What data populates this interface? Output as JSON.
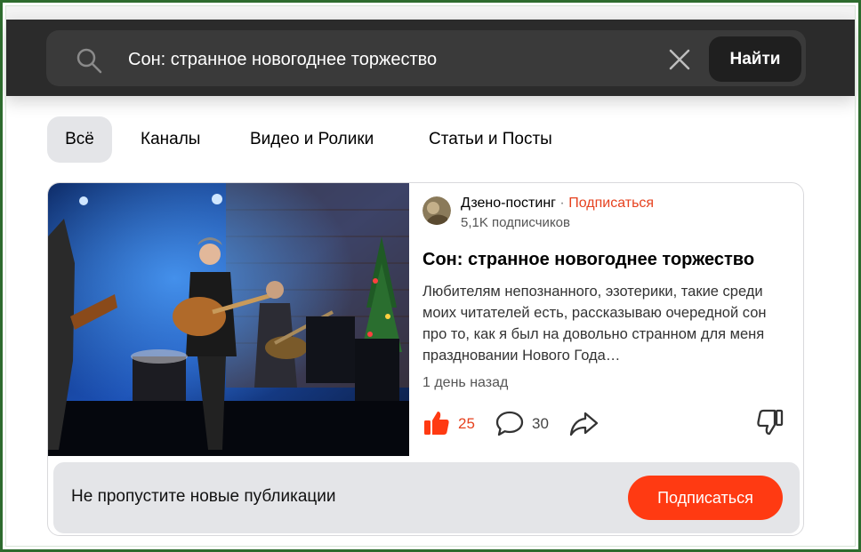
{
  "search": {
    "value": "Сон: странное новогоднее торжество",
    "find_label": "Найти"
  },
  "tabs": [
    {
      "label": "Всё",
      "active": true
    },
    {
      "label": "Каналы",
      "active": false
    },
    {
      "label": "Видео и Ролики",
      "active": false
    },
    {
      "label": "Статьи и Посты",
      "active": false
    }
  ],
  "card": {
    "channel": {
      "name": "Дзено-постинг",
      "separator": " · ",
      "subscribe_label": "Подписаться",
      "subscribers": "5,1K подписчиков"
    },
    "title": "Сон: странное новогоднее торжество",
    "snippet": "Любителям непознанного, эзотерики, такие среди моих читателей есть, рассказываю очередной сон про то, как я был на довольно странном для меня праздновании Нового Года…",
    "time": "1 день назад",
    "likes": "25",
    "comments": "30"
  },
  "subscribe_bar": {
    "text": "Не пропустите новые публикации",
    "button_label": "Подписаться"
  },
  "colors": {
    "accent": "#ff3a12",
    "link": "#e6421f",
    "topbar": "#2b2b2b",
    "frame": "#2d6b2d"
  },
  "icons": {
    "search": "search-icon",
    "clear": "close-icon",
    "like": "thumbs-up-icon",
    "comment": "comment-bubble-icon",
    "share": "share-arrow-icon",
    "dislike": "thumbs-down-icon"
  }
}
